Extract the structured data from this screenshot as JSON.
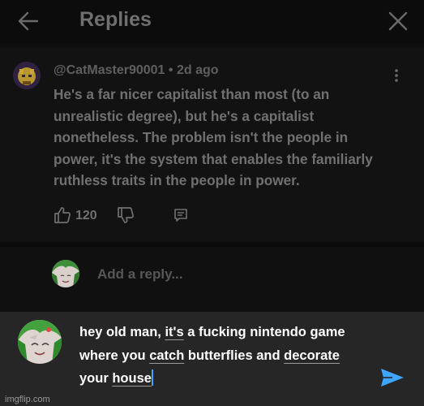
{
  "header": {
    "title": "Replies",
    "back_icon": "arrow-left-icon",
    "close_icon": "close-icon"
  },
  "comment": {
    "author": "@CatMaster90001",
    "separator": "•",
    "age": "2d ago",
    "text": "He's a far nicer capitalist than most (to an unrealistic degree), but he's a capitalist nonetheless. The problem isn't the people in power, it's the system that enables the familiarly ruthless traits in the people in power.",
    "like_count": "120",
    "icons": {
      "like": "thumbs-up-icon",
      "dislike": "thumbs-down-icon",
      "reply": "reply-icon",
      "more": "more-vert-icon"
    }
  },
  "reply_prompt": {
    "placeholder": "Add a reply..."
  },
  "composer": {
    "segments": [
      "hey old man, ",
      "it's",
      " a fucking nintendo game where you ",
      "catch",
      " butterflies and ",
      "decorate",
      " your ",
      "house"
    ],
    "send_icon": "send-icon",
    "accent": "#3ea6ff"
  },
  "watermark": "imgflip.com"
}
